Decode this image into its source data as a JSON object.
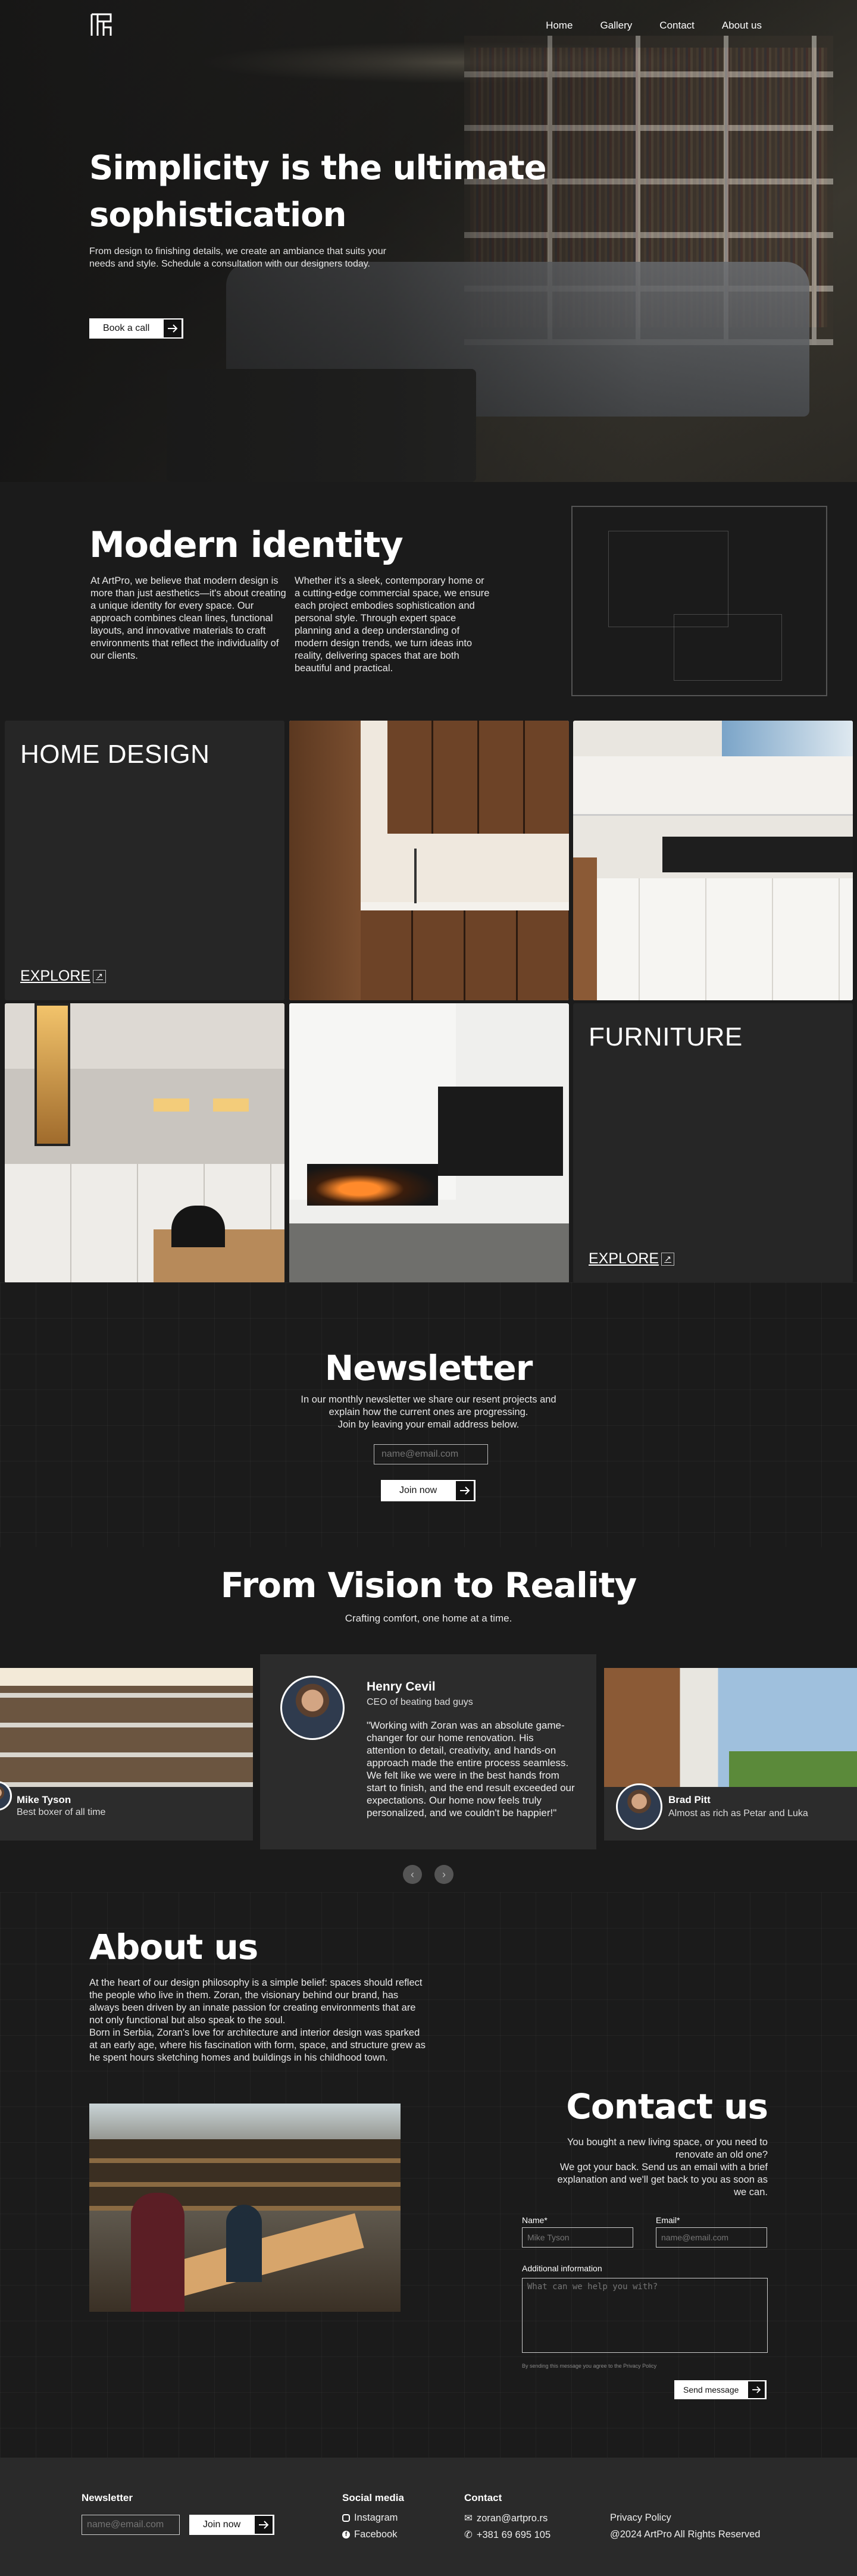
{
  "nav": {
    "home": "Home",
    "gallery": "Gallery",
    "contact": "Contact",
    "about": "About us"
  },
  "hero": {
    "title": "Simplicity is the ultimate sophistication",
    "text": "From design to finishing details, we create an ambiance that suits your needs and style. Schedule a consultation with our designers today.",
    "cta": "Book a call"
  },
  "identity": {
    "title": "Modern identity",
    "col1": "At ArtPro, we believe that modern design is more than just aesthetics—it's about creating a unique identity for every space. Our approach combines clean lines, functional layouts, and innovative materials to craft environments that reflect the individuality of our clients.",
    "col2": "Whether it's a sleek, contemporary home or a cutting-edge commercial space, we ensure each project embodies sophistication and personal style. Through expert space planning and a deep understanding of modern design trends, we turn ideas into reality, delivering spaces that are both beautiful and practical."
  },
  "gallery": {
    "home_design": "HOME DESIGN",
    "furniture": "FURNITURE",
    "explore": "EXPLORE"
  },
  "newsletter": {
    "title": "Newsletter",
    "line1": "In our monthly newsletter we share our resent projects and",
    "line2": "explain how the current ones are progressing.",
    "line3": "Join by leaving your email address below.",
    "placeholder": "name@email.com",
    "button": "Join now"
  },
  "vision": {
    "title": "From Vision to Reality",
    "subtitle": "Crafting comfort, one home at a time."
  },
  "testimonials": [
    {
      "name": "Mike Tyson",
      "role": "Best boxer of all time"
    },
    {
      "name": "Henry Cevil",
      "role": "CEO of beating bad guys",
      "quote": "\"Working with Zoran was an absolute game-changer for our home renovation. His attention to detail, creativity, and hands-on approach made the entire process seamless. We felt like we were in the best hands from start to finish, and the end result exceeded our expectations. Our home now feels truly personalized, and we couldn't be happier!\""
    },
    {
      "name": "Brad Pitt",
      "role": "Almost as rich as Petar and Luka"
    }
  ],
  "about": {
    "title": "About us",
    "p1": "At the heart of our design philosophy is a simple belief: spaces should reflect the people who live in them. Zoran, the visionary behind our brand, has always been driven by an innate passion for creating environments that are not only functional but also speak to the soul.",
    "p2": "Born in Serbia, Zoran's love for architecture and interior design was sparked at an early age, where his fascination with form, space, and structure grew as he spent hours sketching homes and buildings in his childhood town."
  },
  "contact": {
    "title": "Contact us",
    "line1": "You bought a new living space, or you need to",
    "line2": "renovate an old one?",
    "line3": "We got your back. Send us an email with a brief",
    "line4": "explanation and we'll get back to you as soon as",
    "line5": "we can.",
    "name_label": "Name*",
    "name_placeholder": "Mike Tyson",
    "email_label": "Email*",
    "email_placeholder": "name@email.com",
    "info_label": "Additional information",
    "info_placeholder": "What can we help you with?",
    "fine_print": "By sending this message you agree to the Privacy Policy",
    "button": "Send message"
  },
  "footer": {
    "newsletter_title": "Newsletter",
    "placeholder": "name@email.com",
    "button": "Join now",
    "social_title": "Social media",
    "instagram": "Instagram",
    "facebook": "Facebook",
    "contact_title": "Contact",
    "email": "zoran@artpro.rs",
    "phone": "+381 69 695 105",
    "privacy": "Privacy Policy",
    "copyright": "@2024 ArtPro All Rights Reserved"
  }
}
